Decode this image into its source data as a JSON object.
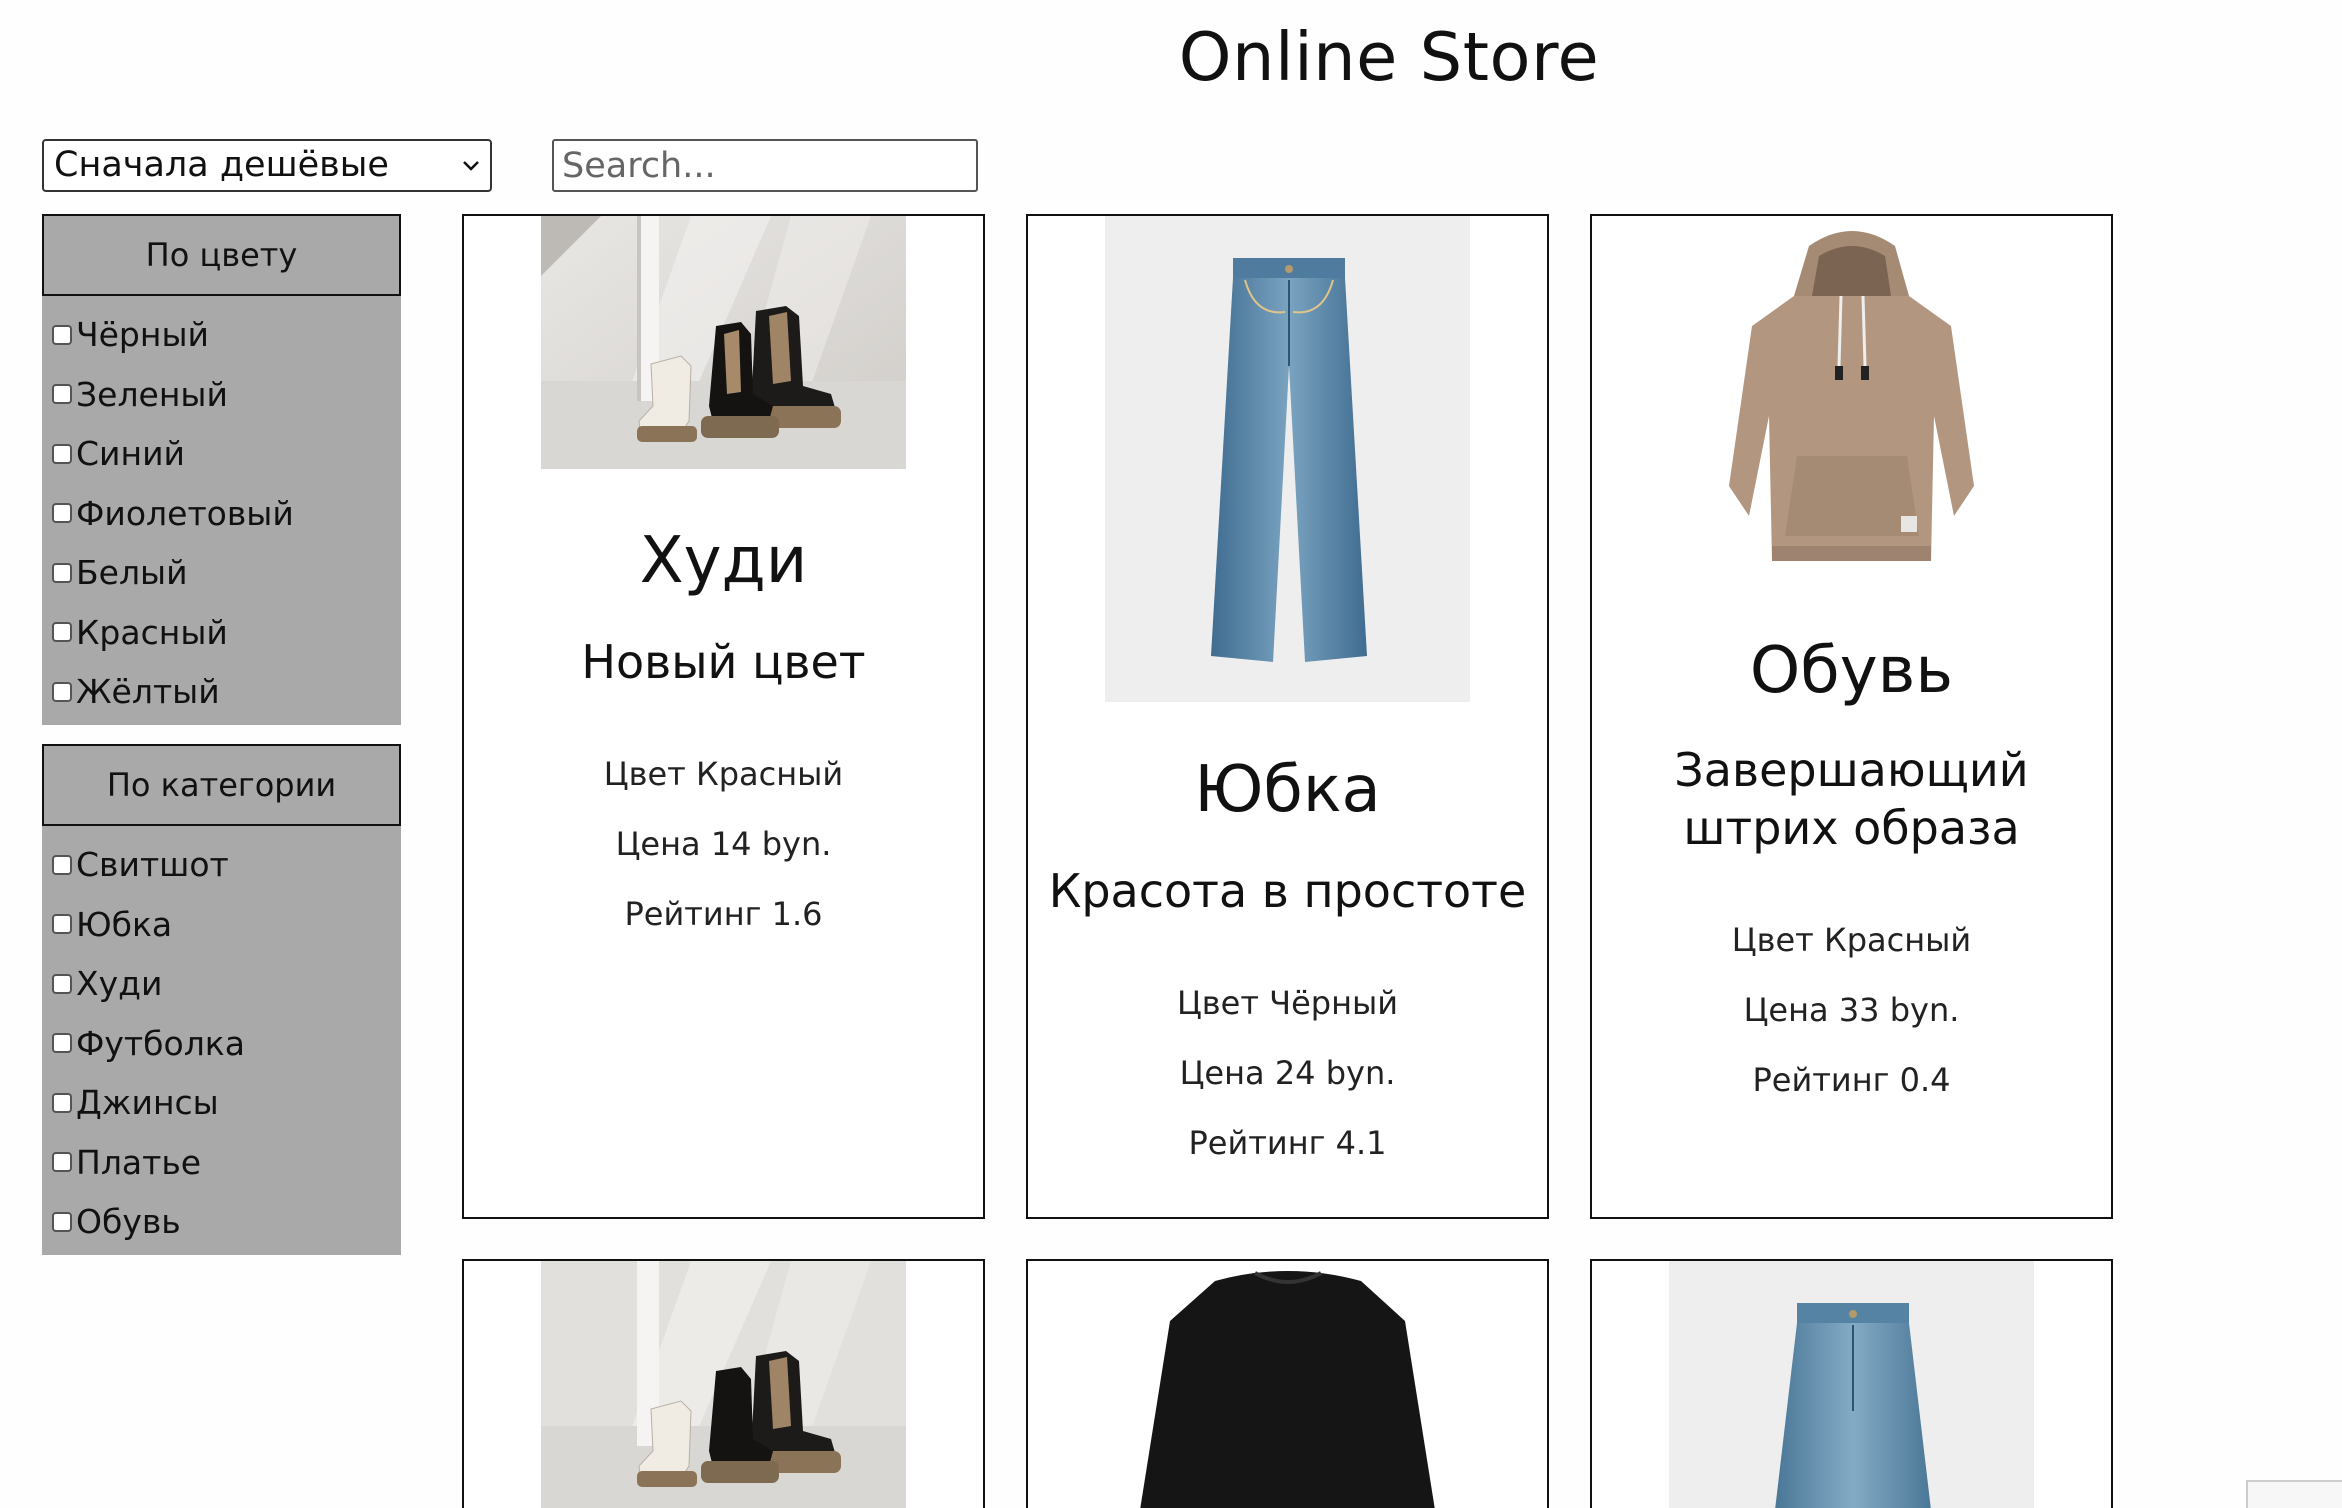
{
  "header": {
    "title": "Online Store"
  },
  "toolbar": {
    "sort_value": "Сначала дешёвые",
    "search_placeholder": "Search..."
  },
  "filters": {
    "color": {
      "title": "По цвету",
      "options": [
        "Чёрный",
        "Зеленый",
        "Синий",
        "Фиолетовый",
        "Белый",
        "Красный",
        "Жёлтый"
      ]
    },
    "category": {
      "title": "По категории",
      "options": [
        "Свитшот",
        "Юбка",
        "Худи",
        "Футболка",
        "Джинсы",
        "Платье",
        "Обувь"
      ]
    }
  },
  "products": [
    {
      "image": "boots-photo",
      "name": "Худи",
      "tagline": "Новый цвет",
      "color": "Цвет Красный",
      "price": "Цена 14 byn.",
      "rating": "Рейтинг 1.6"
    },
    {
      "image": "jeans-photo",
      "name": "Юбка",
      "tagline": "Красота в простоте",
      "color": "Цвет Чёрный",
      "price": "Цена 24 byn.",
      "rating": "Рейтинг 4.1"
    },
    {
      "image": "hoodie-photo",
      "name": "Обувь",
      "tagline": "Завершающий штрих образа",
      "color": "Цвет Красный",
      "price": "Цена 33 byn.",
      "rating": "Рейтинг 0.4"
    },
    {
      "image": "boots-photo"
    },
    {
      "image": "sweatshirt-photo"
    },
    {
      "image": "jeans-photo"
    }
  ],
  "colors": {
    "sidebar_bg": "#a9a9a9",
    "border": "#111111",
    "page_bg": "#fefefe"
  }
}
